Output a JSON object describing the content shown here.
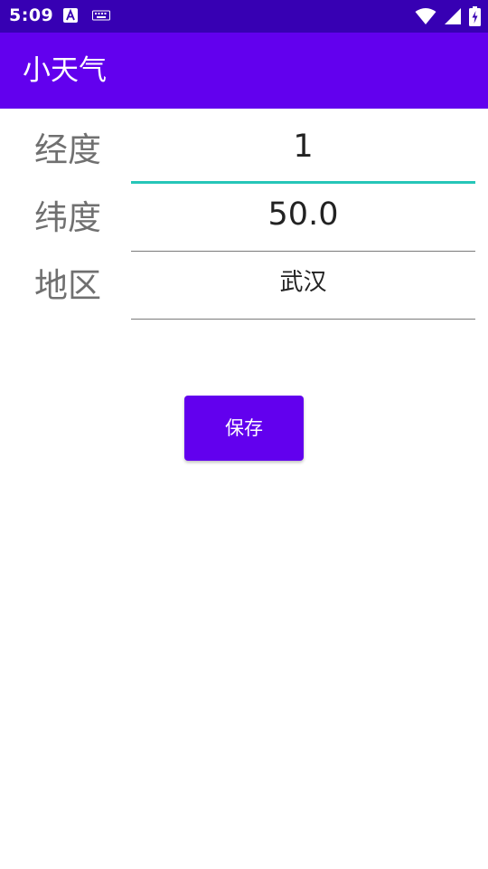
{
  "status_bar": {
    "time": "5:09",
    "bg_color": "#3700b3"
  },
  "app_bar": {
    "title": "小天气",
    "bg_color": "#6200ee"
  },
  "form": {
    "longitude": {
      "label": "经度",
      "value": "1"
    },
    "latitude": {
      "label": "纬度",
      "value": "50.0"
    },
    "region": {
      "label": "地区",
      "value": "武汉"
    }
  },
  "actions": {
    "save_label": "保存"
  },
  "colors": {
    "accent": "#26c6b8",
    "primary": "#6200ee"
  },
  "icons": [
    "a-notification-icon",
    "keyboard-icon",
    "wifi-icon",
    "cell-signal-icon",
    "battery-charging-icon"
  ]
}
